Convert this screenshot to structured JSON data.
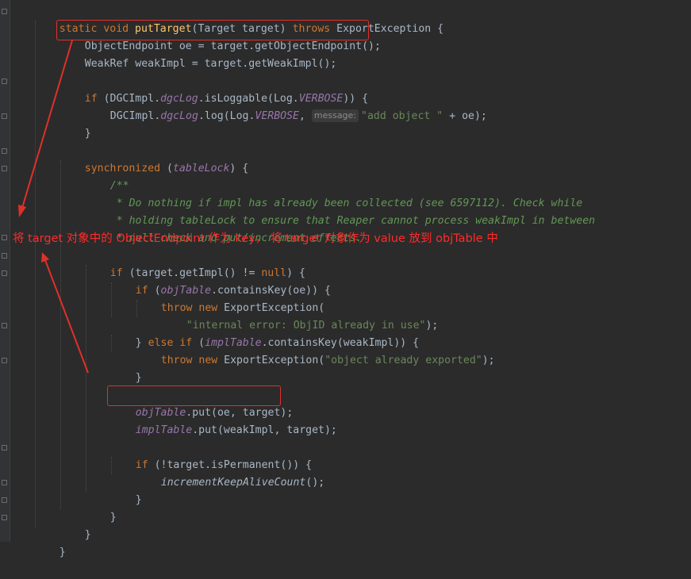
{
  "code": {
    "l1": {
      "t1": "static void ",
      "t2": "putTarget",
      "t3": "(Target target) ",
      "t4": "throws",
      "t5": " ExportException {"
    },
    "l2": {
      "t1": "ObjectEndpoint oe = target.getObjectEndpoint();"
    },
    "l3": {
      "t1": "WeakRef weakImpl = target.getWeakImpl();"
    },
    "l4": {
      "t1": "if",
      "t2": " (DGCImpl.",
      "t3": "dgcLog",
      "t4": ".isLoggable(Log.",
      "t5": "VERBOSE",
      "t6": ")) {"
    },
    "l5": {
      "t1": "DGCImpl.",
      "t2": "dgcLog",
      "t3": ".log(Log.",
      "t4": "VERBOSE",
      "t5": ", ",
      "hint": "message:",
      "t6": "\"add object \"",
      "t7": " + oe);"
    },
    "l6": {
      "t1": "}"
    },
    "l7": {
      "t1": "synchronized",
      "t2": " (",
      "t3": "tableLock",
      "t4": ") {"
    },
    "l8": {
      "t1": "/**"
    },
    "l9": {
      "t1": " * Do nothing if impl has already been collected (see 6597112). Check while"
    },
    "l10": {
      "t1": " * holding tableLock to ensure that Reaper cannot process weakImpl in between"
    },
    "l11": {
      "t1": " * null check and put/increment effects."
    },
    "l12": {
      "t1": "if",
      "t2": " (target.getImpl() != ",
      "t3": "null",
      "t4": ") {"
    },
    "l13": {
      "t1": "if",
      "t2": " (",
      "t3": "objTable",
      "t4": ".containsKey(oe)) {"
    },
    "l14": {
      "t1": "throw new",
      "t2": " ExportException("
    },
    "l15": {
      "t1": "\"internal error: ObjID already in use\"",
      "t2": ");"
    },
    "l16": {
      "t1": "} ",
      "t2": "else if",
      "t3": " (",
      "t4": "implTable",
      "t5": ".containsKey(weakImpl)) {"
    },
    "l17": {
      "t1": "throw new",
      "t2": " ExportException(",
      "t3": "\"object already exported\"",
      "t4": ");"
    },
    "l18": {
      "t1": "}"
    },
    "l19": {
      "t1": "objTable",
      "t2": ".put(oe, target);"
    },
    "l20": {
      "t1": "implTable",
      "t2": ".put(weakImpl, target);"
    },
    "l21": {
      "t1": "if",
      "t2": " (!target.isPermanent()) {"
    },
    "l22": {
      "t1": "incrementKeepAliveCount",
      "t2": "();"
    },
    "l23": {
      "t1": "}"
    },
    "l24": {
      "t1": "}"
    },
    "l25": {
      "t1": "}"
    },
    "l26": {
      "t1": "}"
    }
  },
  "annotation": {
    "text": "将 target 对象中的 ObjectEndpoint 作为 key， 将 target 对象作为 value 放到 objTable 中"
  },
  "colors": {
    "background": "#2b2b2b",
    "keyword": "#cc7832",
    "method_decl": "#ffc66d",
    "field": "#9876aa",
    "comment": "#629755",
    "string": "#6a8759",
    "annotation": "#ff2b2b"
  }
}
